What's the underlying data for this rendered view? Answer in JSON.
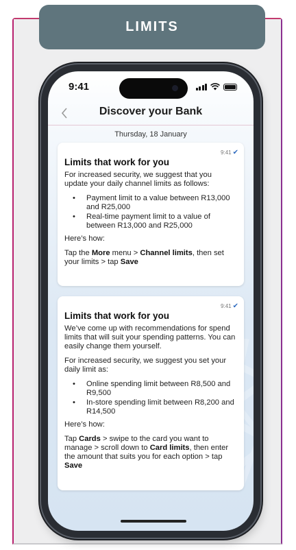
{
  "banner": {
    "title": "LIMITS"
  },
  "phone": {
    "status_time": "9:41",
    "nav_title": "Discover your Bank",
    "date": "Thursday, 18 January"
  },
  "messages": [
    {
      "time": "9:41",
      "title": "Limits that work for you",
      "intro": "For increased security, we suggest that you update your daily channel limits as follows:",
      "bullets": [
        "Payment limit to a value between R13,000 and R25,000",
        "Real-time payment limit to a value of between R13,000 and R25,000"
      ],
      "howto_label": "Here’s how:",
      "steps": {
        "t1": "Tap the ",
        "b1": "More",
        "t2": " menu > ",
        "b2": "Channel limits",
        "t3": ", then set your limits > tap ",
        "b3": "Save"
      }
    },
    {
      "time": "9:41",
      "title": "Limits that work for you",
      "intro": "We’ve come up with recommendations for spend limits that will suit your spending patterns. You can easily change them yourself.",
      "intro2": "For increased security, we suggest you set your daily limit as:",
      "bullets": [
        "Online spending limit between R8,500 and R9,500",
        "In-store spending limit between R8,200 and R14,500"
      ],
      "howto_label": "Here’s how:",
      "steps": {
        "t1": "Tap ",
        "b1": "Cards",
        "t2": " > swipe to the card you want to manage > scroll down to ",
        "b2": "Card limits",
        "t3": ", then enter the amount that suits you for each option > tap ",
        "b3": "Save"
      }
    }
  ],
  "colors": {
    "banner": "#5f757d",
    "accent_left": "#c6217a",
    "accent_right": "#8b2f8f",
    "tick": "#2f6bbf"
  },
  "icons": [
    "back-chevron-icon",
    "signal-icon",
    "wifi-icon",
    "battery-icon",
    "read-tick-icon"
  ]
}
